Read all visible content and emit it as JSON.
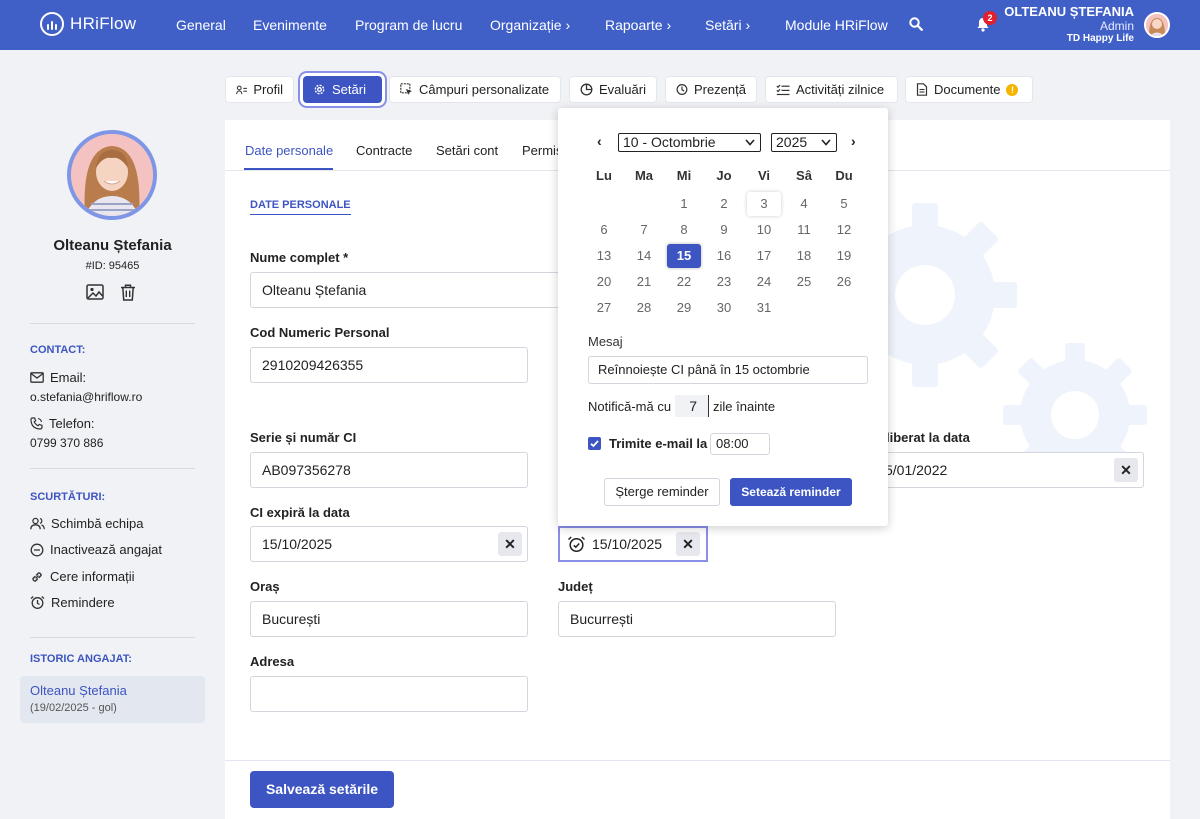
{
  "topbar": {
    "brand": "HRiFlow",
    "nav": [
      "General",
      "Evenimente",
      "Program de lucru",
      "Organizație",
      "Rapoarte",
      "Setări",
      "Module HRiFlow"
    ],
    "notifications_count": "2",
    "user_name": "OLTEANU ȘTEFANIA",
    "user_role": "Admin",
    "company": "TD Happy Life"
  },
  "tabs": [
    "Profil",
    "Setări",
    "Câmpuri personalizate",
    "Evaluări",
    "Prezență",
    "Activități zilnice",
    "Documente"
  ],
  "sidebar": {
    "name": "Olteanu Ștefania",
    "id": "#ID: 95465",
    "contact_title": "CONTACT:",
    "email_label": "Email:",
    "email": "o.stefania@hriflow.ro",
    "phone_label": "Telefon:",
    "phone": "0799 370 886",
    "shortcuts_title": "SCURTĂTURI:",
    "shortcuts": [
      "Schimbă echipa",
      "Inactivează angajat",
      "Cere informații",
      "Remindere"
    ],
    "history_title": "ISTORIC ANGAJAT:",
    "history_name": "Olteanu Ștefania",
    "history_dates": "(19/02/2025 - gol)"
  },
  "subtabs": [
    "Date personale",
    "Contracte",
    "Setări cont",
    "Permis"
  ],
  "form": {
    "section": "DATE PERSONALE",
    "full_name_label": "Nume complet *",
    "full_name": "Olteanu Ștefania",
    "cnp_label": "Cod Numeric Personal",
    "cnp": "2910209426355",
    "ci_series_label": "Serie și număr CI",
    "ci_series": "AB097356278",
    "issued_label": "liberat la data",
    "issued": "5/01/2022",
    "ci_expiry_label": "CI expiră la data",
    "ci_expiry": "15/10/2025",
    "reminder_date": "15/10/2025",
    "city_label": "Oraș",
    "city": "București",
    "county_label": "Județ",
    "county": "Bucurrești",
    "address_label": "Adresa",
    "address": "",
    "save": "Salvează setările"
  },
  "popup": {
    "month": "10 - Octombrie",
    "year": "2025",
    "weekdays": [
      "Lu",
      "Ma",
      "Mi",
      "Jo",
      "Vi",
      "Sâ",
      "Du"
    ],
    "days": [
      "1",
      "2",
      "3",
      "4",
      "5",
      "6",
      "7",
      "8",
      "9",
      "10",
      "11",
      "12",
      "13",
      "14",
      "15",
      "16",
      "17",
      "18",
      "19",
      "20",
      "21",
      "22",
      "23",
      "24",
      "25",
      "26",
      "27",
      "28",
      "29",
      "30",
      "31"
    ],
    "message_label": "Mesaj",
    "message": "Reînnoiește CI până în 15 octombrie",
    "notify_prefix": "Notifică-mă cu",
    "notify_days": "7",
    "notify_suffix": "zile înainte",
    "email_label": "Trimite e-mail la",
    "email_time": "08:00",
    "delete_btn": "Șterge reminder",
    "set_btn": "Setează reminder"
  }
}
